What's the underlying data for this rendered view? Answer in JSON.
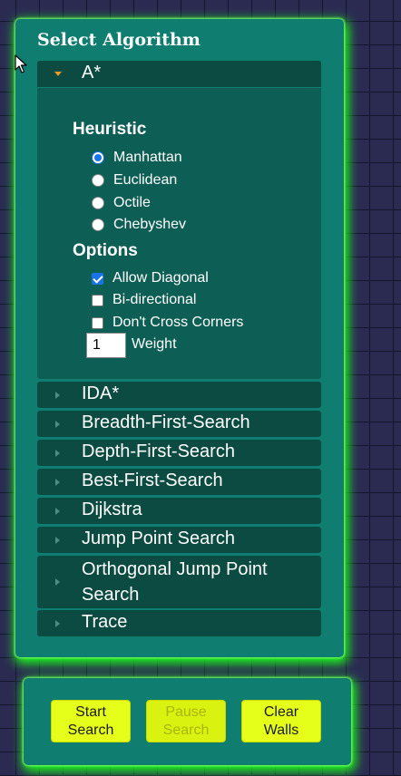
{
  "panel": {
    "title": "Select Algorithm",
    "expanded": {
      "label": "A*",
      "heuristic_title": "Heuristic",
      "heuristics": [
        {
          "label": "Manhattan",
          "checked": true
        },
        {
          "label": "Euclidean",
          "checked": false
        },
        {
          "label": "Octile",
          "checked": false
        },
        {
          "label": "Chebyshev",
          "checked": false
        }
      ],
      "options_title": "Options",
      "options": [
        {
          "label": "Allow Diagonal",
          "checked": true
        },
        {
          "label": "Bi-directional",
          "checked": false
        },
        {
          "label": "Don't Cross Corners",
          "checked": false
        }
      ],
      "weight_value": "1",
      "weight_label": "Weight"
    },
    "algorithms": [
      "IDA*",
      "Breadth-First-Search",
      "Depth-First-Search",
      "Best-First-Search",
      "Dijkstra",
      "Jump Point Search",
      "Orthogonal Jump Point Search",
      "Trace"
    ]
  },
  "controls": {
    "start": "Start Search",
    "pause": "Pause Search",
    "clear": "Clear Walls"
  },
  "colors": {
    "background": "#2b2b52",
    "panel": "#0f7d6f",
    "header": "#0b4b42",
    "glow": "#1aff1a",
    "button": "#e5ff1a"
  }
}
